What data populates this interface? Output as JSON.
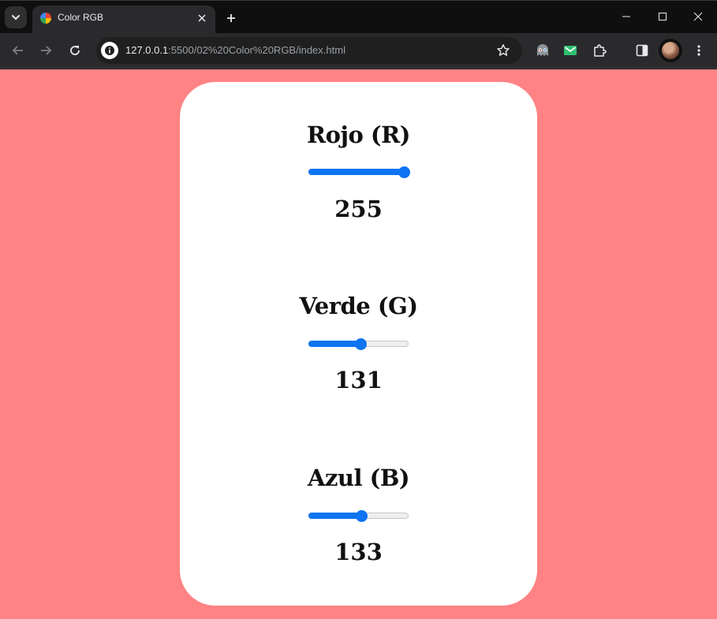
{
  "browser": {
    "tab_title": "Color RGB",
    "url_host": "127.0.0.1",
    "url_rest": ":5500/02%20Color%20RGB/index.html"
  },
  "page": {
    "background_color": "#ff8385",
    "accent_color": "#0e74f1",
    "channels": [
      {
        "label": "Rojo (R)",
        "value": "255",
        "level": 1.0
      },
      {
        "label": "Verde (G)",
        "value": "131",
        "level": 0.5137
      },
      {
        "label": "Azul (B)",
        "value": "133",
        "level": 0.5216
      }
    ]
  },
  "icons": {
    "tab_search": "chevron-down-icon",
    "tab_close": "close-icon",
    "new_tab": "plus-icon",
    "back": "arrow-left-icon",
    "forward": "arrow-right-icon",
    "reload": "reload-icon",
    "site_info": "info-icon",
    "bookmark": "star-icon",
    "extensions": [
      "ghost-extension-icon",
      "mail-extension-icon",
      "puzzle-icon"
    ],
    "side_panel": "side-panel-icon",
    "menu": "kebab-menu-icon"
  }
}
